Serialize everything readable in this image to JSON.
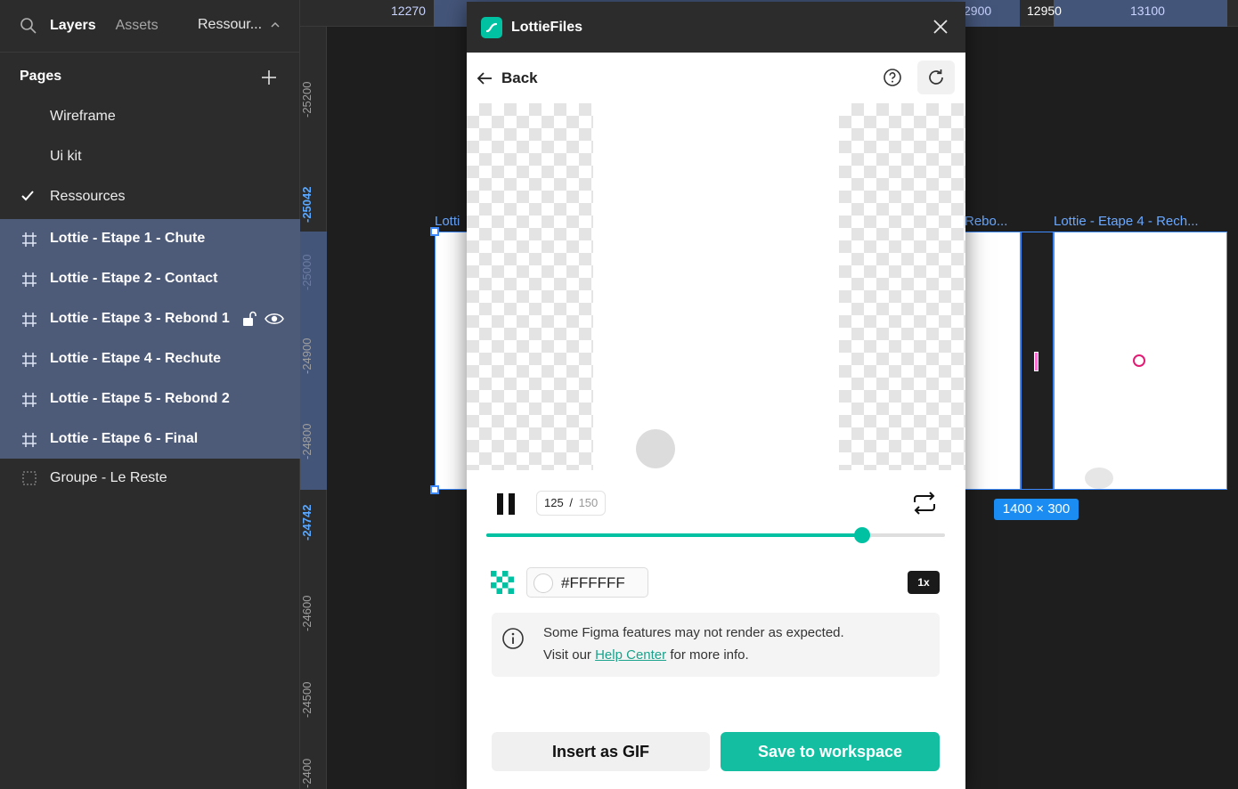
{
  "left_panel": {
    "tabs": {
      "layers": "Layers",
      "assets": "Assets",
      "page": "Ressour..."
    },
    "pages_heading": "Pages",
    "pages": [
      {
        "label": "Wireframe"
      },
      {
        "label": "Ui kit"
      },
      {
        "label": "Ressources",
        "selected": true
      }
    ],
    "layers": [
      {
        "label": "Lottie - Etape 1 - Chute"
      },
      {
        "label": "Lottie - Etape 2 - Contact"
      },
      {
        "label": "Lottie - Etape 3 - Rebond 1"
      },
      {
        "label": "Lottie - Etape 4 - Rechute"
      },
      {
        "label": "Lottie - Etape 5 - Rebond 2"
      },
      {
        "label": "Lottie - Etape 6 - Final"
      }
    ],
    "group": {
      "label": "Groupe - Le Reste"
    }
  },
  "rulers": {
    "top": [
      "12270",
      "2900",
      "12950",
      "13100"
    ],
    "left": [
      "-25200",
      "-25042",
      "-25000",
      "-24900",
      "-24800",
      "-24742",
      "-24600",
      "-24500",
      "-2400"
    ]
  },
  "canvas": {
    "frame_labels": [
      "Lotti",
      "Rebo...",
      "Lottie - Etape 4 - Rech..."
    ],
    "size_badge": "1400 × 300"
  },
  "plugin": {
    "title": "LottieFiles",
    "back_label": "Back",
    "player": {
      "current_frame": "125",
      "separator": "/",
      "total_frames": "150",
      "progress": 0.82
    },
    "background_color": "#FFFFFF",
    "speed": "1x",
    "notice": {
      "line1": "Some Figma features may not render as expected.",
      "line2_before": "Visit our",
      "link": "Help Center",
      "line2_after": "for more info."
    },
    "buttons": {
      "insert_gif": "Insert as GIF",
      "save": "Save to workspace"
    }
  },
  "colors": {
    "accent": "#00C1A2",
    "selection": "#3D8BFF",
    "layer_highlight": "#4D5A78"
  }
}
